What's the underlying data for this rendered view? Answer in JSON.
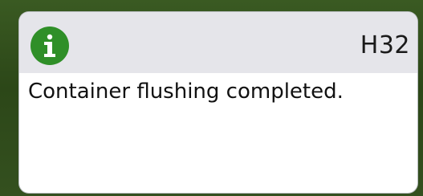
{
  "dialog": {
    "icon": "info-icon",
    "code": "H32",
    "message": "Container flushing completed."
  },
  "colors": {
    "background": "#2e4a1e",
    "header": "#e5e5ea",
    "icon_green": "#2f8f28",
    "text": "#111111"
  }
}
